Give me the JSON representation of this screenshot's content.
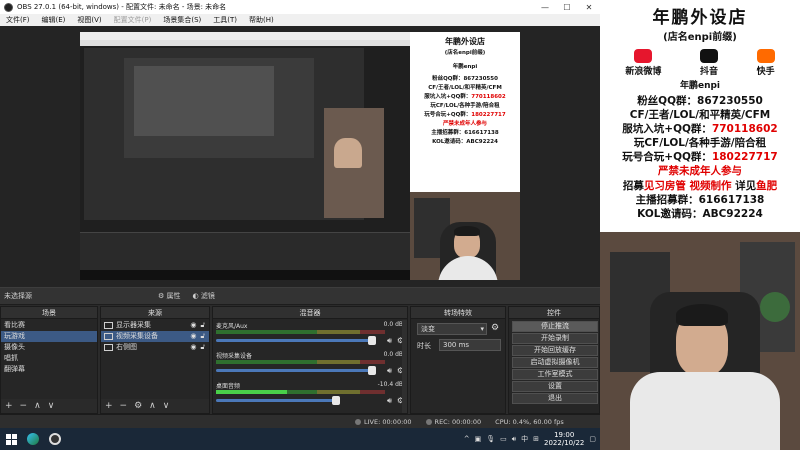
{
  "window": {
    "title": "OBS 27.0.1 (64-bit, windows) - 配置文件: 未命名 - 场景: 未命名"
  },
  "menu": [
    "文件(F)",
    "编辑(E)",
    "视图(V)",
    "配置文件(P)",
    "场景集合(S)",
    "工具(T)",
    "帮助(H)"
  ],
  "strip": {
    "no_source": "未选择源",
    "properties": "属性",
    "filters": "滤镜"
  },
  "scenes": {
    "title": "场景",
    "items": [
      "看比赛",
      "玩游戏",
      "摄像头",
      "唱抓",
      "翻弹幕"
    ],
    "selected_index": 1
  },
  "sources": {
    "title": "来源",
    "items": [
      "显示器采集",
      "视频采集设备",
      "右侧图"
    ],
    "selected_index": 1
  },
  "mixer": {
    "title": "混音器",
    "channels": [
      {
        "name": "麦克风/Aux",
        "db": "0.0 dB",
        "level": 0.0
      },
      {
        "name": "视频采集设备",
        "db": "0.0 dB",
        "level": 0.0
      },
      {
        "name": "桌面音频",
        "db": "-10.4 dB",
        "level": 0.42
      }
    ]
  },
  "transitions": {
    "title": "转场特效",
    "selected": "淡变",
    "duration_label": "时长",
    "duration": "300 ms"
  },
  "controls": {
    "title": "控件",
    "buttons": [
      "停止推流",
      "开始录制",
      "开始回放缓存",
      "启动虚拟摄像机",
      "工作室模式",
      "设置",
      "退出"
    ],
    "active_index": 0
  },
  "status": {
    "live": "LIVE: 00:00:00",
    "rec": "REC: 00:00:00",
    "cpu": "CPU: 0.4%, 60.00 fps"
  },
  "taskbar": {
    "time": "19:00",
    "date": "2022/10/22",
    "ime": "中"
  },
  "banner": {
    "title": "年鹏外设店",
    "subtitle": "(店名enpi前缀)",
    "platforms": [
      "新浪微博",
      "抖音",
      "快手"
    ],
    "name": "年鹏enpi",
    "line1_label": "粉丝QQ群：",
    "line1_value": "867230550",
    "line2": "CF/王者/LOL/和平精英/CFM",
    "line3_label": "服坑入坑+QQ群：",
    "line3_value": "770118602",
    "line4": "玩CF/LOL/各种手游/陪合租",
    "line5_label": "玩号合玩+QQ群：",
    "line5_value": "180227717",
    "line6": "严禁未成年人参与",
    "line7a": "招募",
    "line7b": "见习房管",
    "line7c": "视频制作",
    "line7d": "详见",
    "line7e": "鱼肥",
    "line8": "主播招募群：616617138",
    "line9": "KOL邀请码：ABC92224"
  },
  "colors": {
    "accent_red": "#e00000",
    "selection": "#3c5a85",
    "fader": "#4b78b8"
  }
}
